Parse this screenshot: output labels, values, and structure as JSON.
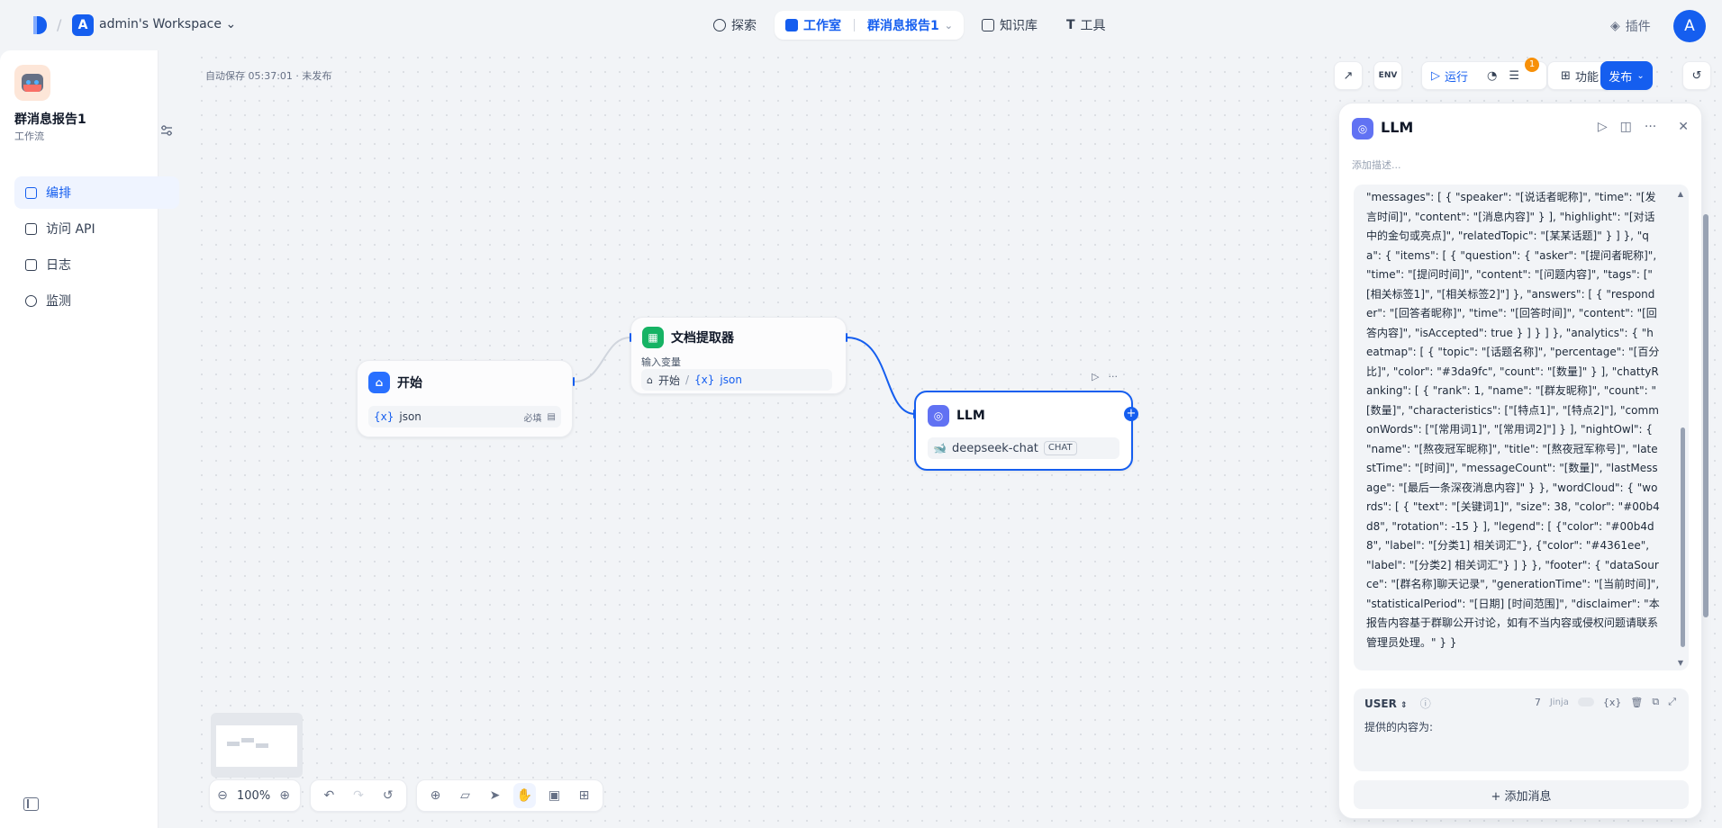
{
  "header": {
    "workspace_initial": "A",
    "workspace_name": "admin's Workspace",
    "nav": {
      "explore": "探索",
      "studio": "工作室",
      "current_app": "群消息报告1",
      "knowledge": "知识库",
      "tools": "工具"
    },
    "plugins": "插件",
    "user_initial": "A"
  },
  "sidebar": {
    "app_name": "群消息报告1",
    "app_type": "工作流",
    "items": [
      {
        "label": "编排",
        "icon": "layout-icon"
      },
      {
        "label": "访问 API",
        "icon": "terminal-icon"
      },
      {
        "label": "日志",
        "icon": "log-icon"
      },
      {
        "label": "监测",
        "icon": "monitor-icon"
      }
    ]
  },
  "canvas": {
    "autosave": "自动保存 05:37:01 · 未发布",
    "zoom": "100%",
    "nodes": {
      "start": {
        "title": "开始",
        "var_prefix": "{x}",
        "var_name": "json",
        "required": "必填"
      },
      "extractor": {
        "title": "文档提取器",
        "input_label": "输入变量",
        "source": "开始",
        "sep": "/",
        "var_prefix": "{x}",
        "var_name": "json"
      },
      "llm": {
        "title": "LLM",
        "model": "deepseek-chat",
        "mode_tag": "CHAT"
      }
    }
  },
  "toolbar": {
    "env": "ENV",
    "run": "运行",
    "badge": "1",
    "features": "功能",
    "publish": "发布"
  },
  "panel": {
    "title": "LLM",
    "desc_placeholder": "添加描述...",
    "system_prompt": "\"messages\": [ { \"speaker\": \"[说话者昵称]\", \"time\": \"[发言时间]\", \"content\": \"[消息内容]\" } ], \"highlight\": \"[对话中的金句或亮点]\", \"relatedTopic\": \"[某某话题]\" } ] }, \"qa\": { \"items\": [ { \"question\": { \"asker\": \"[提问者昵称]\", \"time\": \"[提问时间]\", \"content\": \"[问题内容]\", \"tags\": [\"[相关标签1]\", \"[相关标签2]\"] }, \"answers\": [ { \"responder\": \"[回答者昵称]\", \"time\": \"[回答时间]\", \"content\": \"[回答内容]\", \"isAccepted\": true } ] } ] }, \"analytics\": { \"heatmap\": [ { \"topic\": \"[话题名称]\", \"percentage\": \"[百分比]\", \"color\": \"#3da9fc\", \"count\": \"[数量]\" } ], \"chattyRanking\": [ { \"rank\": 1, \"name\": \"[群友昵称]\", \"count\": \"[数量]\", \"characteristics\": [\"[特点1]\", \"[特点2]\"], \"commonWords\": [\"[常用词1]\", \"[常用词2]\"] } ], \"nightOwl\": { \"name\": \"[熬夜冠军昵称]\", \"title\": \"[熬夜冠军称号]\", \"latestTime\": \"[时间]\", \"messageCount\": \"[数量]\", \"lastMessage\": \"[最后一条深夜消息内容]\" } }, \"wordCloud\": { \"words\": [ { \"text\": \"[关键词1]\", \"size\": 38, \"color\": \"#00b4d8\", \"rotation\": -15 } ], \"legend\": [ {\"color\": \"#00b4d8\", \"label\": \"[分类1] 相关词汇\"}, {\"color\": \"#4361ee\", \"label\": \"[分类2] 相关词汇\"} ] } }, \"footer\": { \"dataSource\": \"[群名称]聊天记录\", \"generationTime\": \"[当前时间]\", \"statisticalPeriod\": \"[日期] [时间范围]\", \"disclaimer\": \"本报告内容基于群聊公开讨论，如有不当内容或侵权问题请联系管理员处理。\" } }",
    "user_role": "USER",
    "user_count": "7",
    "jinja": "Jinja",
    "var_tool": "{x}",
    "user_prompt": "提供的内容为:",
    "add_message": "+ 添加消息"
  },
  "colors": {
    "primary": "#155eef",
    "start_icon": "#2970ff",
    "extractor_icon": "#16b364",
    "llm_icon": "#6172f3"
  }
}
